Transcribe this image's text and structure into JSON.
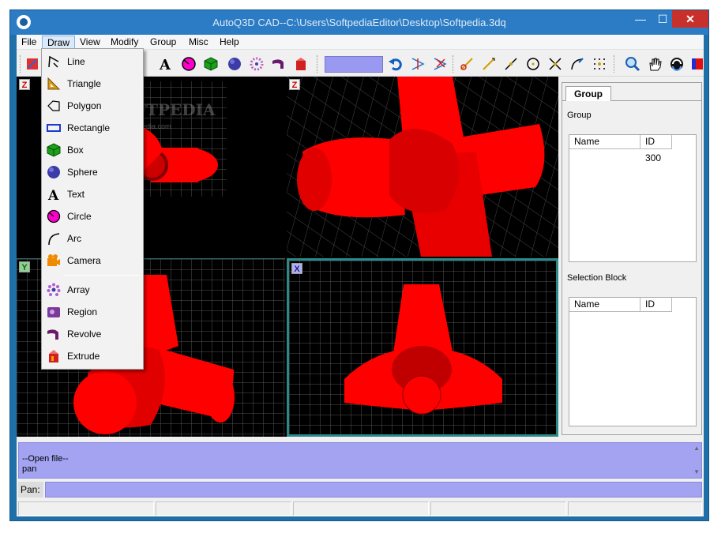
{
  "window": {
    "title": "AutoQ3D CAD--C:\\Users\\SoftpediaEditor\\Desktop\\Softpedia.3dq",
    "min_label": "—",
    "max_label": "☐",
    "close_label": "✕"
  },
  "menubar": {
    "items": [
      {
        "label": "File"
      },
      {
        "label": "Draw"
      },
      {
        "label": "View"
      },
      {
        "label": "Modify"
      },
      {
        "label": "Group"
      },
      {
        "label": "Misc"
      },
      {
        "label": "Help"
      }
    ]
  },
  "draw_menu": {
    "items": [
      {
        "label": "Line",
        "icon": "line-icon"
      },
      {
        "label": "Triangle",
        "icon": "triangle-icon"
      },
      {
        "label": "Polygon",
        "icon": "polygon-icon"
      },
      {
        "label": "Rectangle",
        "icon": "rectangle-icon"
      },
      {
        "label": "Box",
        "icon": "box-icon"
      },
      {
        "label": "Sphere",
        "icon": "sphere-icon"
      },
      {
        "label": "Text",
        "icon": "text-icon"
      },
      {
        "label": "Circle",
        "icon": "circle-icon"
      },
      {
        "label": "Arc",
        "icon": "arc-icon"
      },
      {
        "label": "Camera",
        "icon": "camera-icon"
      },
      {
        "label": "Array",
        "icon": "array-icon"
      },
      {
        "label": "Region",
        "icon": "region-icon"
      },
      {
        "label": "Revolve",
        "icon": "revolve-icon"
      },
      {
        "label": "Extrude",
        "icon": "extrude-icon"
      }
    ]
  },
  "viewports": {
    "top_left_tag": "Z",
    "top_right_tag": "Z",
    "bottom_left_tag": "Y",
    "bottom_right_tag": "X",
    "watermark": "SOFTPEDIA",
    "watermark_sub": "www.softpedia.com"
  },
  "panel": {
    "tab_label": "Group",
    "group_label": "Group",
    "group_table": {
      "columns": [
        "Name",
        "ID"
      ],
      "rows": [
        {
          "name": "",
          "id": "300"
        }
      ]
    },
    "selection_label": "Selection Block",
    "selection_table": {
      "columns": [
        "Name",
        "ID"
      ],
      "rows": []
    }
  },
  "console": {
    "lines": [
      "--Open file--",
      "pan"
    ]
  },
  "command": {
    "label": "Pan:",
    "value": ""
  },
  "colors": {
    "object_red": "#ff0000",
    "grid_line": "#555555",
    "viewport_active_border": "#2a8a8a",
    "console_bg": "#a3a3f2"
  }
}
